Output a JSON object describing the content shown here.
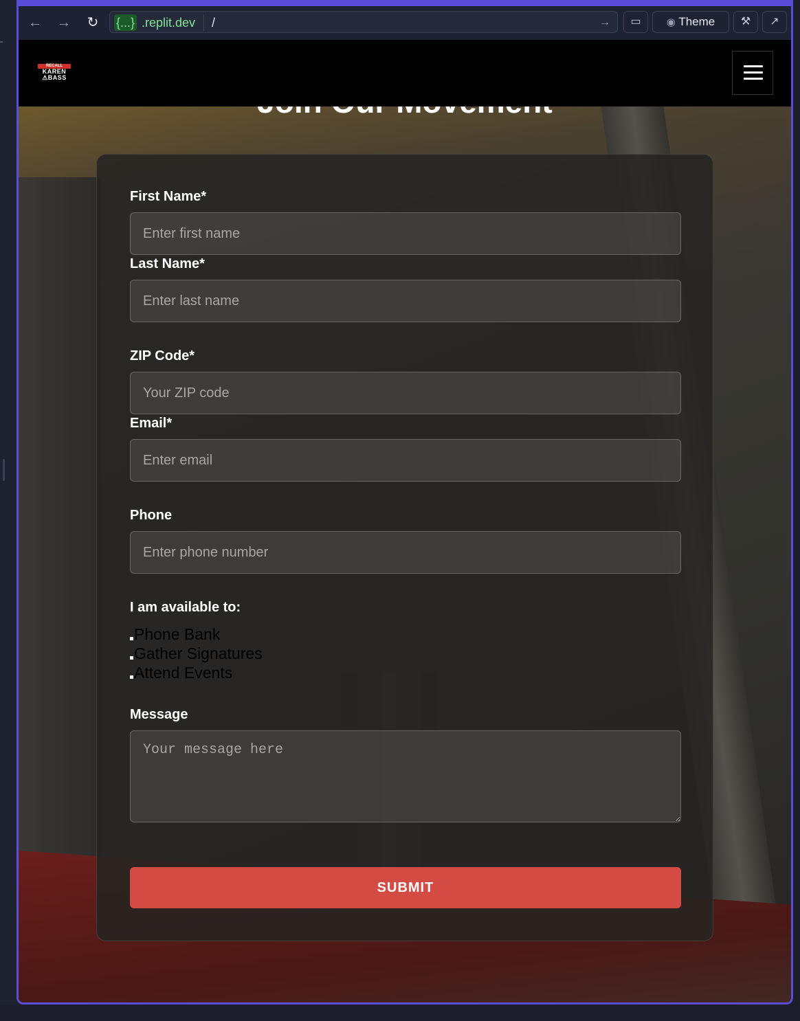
{
  "browser": {
    "url_host_badge": "{...}",
    "url_host": ".replit.dev",
    "url_path": "/",
    "theme_label": "Theme"
  },
  "site": {
    "logo": {
      "line1": "RECALL",
      "line2": "KAREN",
      "line3": "⚠BASS"
    },
    "heading": "Join Our Movement"
  },
  "form": {
    "first_name": {
      "label": "First Name*",
      "placeholder": "Enter first name"
    },
    "last_name": {
      "label": "Last Name*",
      "placeholder": "Enter last name"
    },
    "zip": {
      "label": "ZIP Code*",
      "placeholder": "Your ZIP code"
    },
    "email": {
      "label": "Email*",
      "placeholder": "Enter email"
    },
    "phone": {
      "label": "Phone",
      "placeholder": "Enter phone number"
    },
    "availability": {
      "label": "I am available to:",
      "options": [
        "Phone Bank",
        "Gather Signatures",
        "Attend Events"
      ]
    },
    "message": {
      "label": "Message",
      "placeholder": "Your message here"
    },
    "submit_label": "SUBMIT"
  },
  "colors": {
    "frame": "#5a4ed8",
    "submit": "#d34b43",
    "url_host": "#86e29a"
  }
}
